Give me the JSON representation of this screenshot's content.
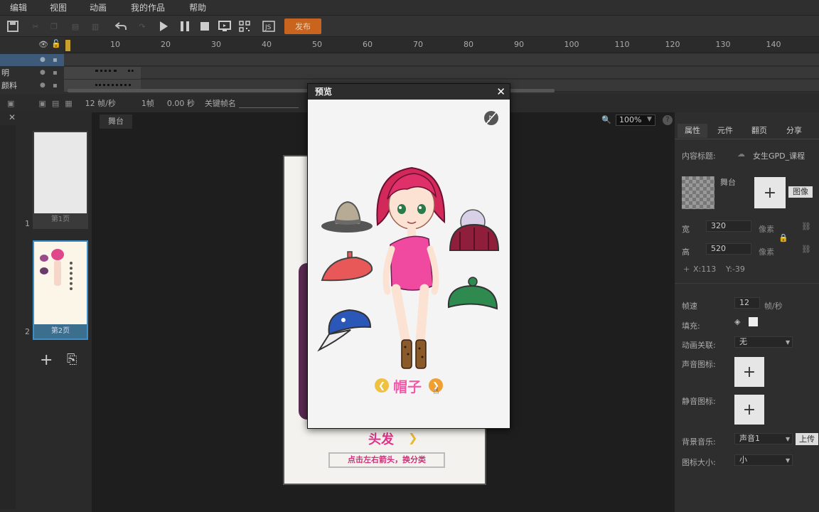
{
  "menubar": {
    "items": [
      "编辑",
      "视图",
      "动画",
      "我的作品",
      "帮助"
    ]
  },
  "toolbar": {
    "publish_label": "发布"
  },
  "timeline": {
    "ruler_ticks": [
      "10",
      "20",
      "30",
      "40",
      "50",
      "60",
      "70",
      "80",
      "90",
      "100",
      "110",
      "120",
      "130",
      "140"
    ],
    "layers": [
      "",
      "明",
      "颜料"
    ],
    "status": {
      "fps": "12 帧/秒",
      "frame": "1帧",
      "time": "0.00 秒",
      "keyframe_label": "关键帧名"
    }
  },
  "pages": {
    "items": [
      {
        "number": "1",
        "label": "第1页"
      },
      {
        "number": "2",
        "label": "第2页"
      }
    ]
  },
  "stage": {
    "tab_label": "舞台",
    "zoom": "100%"
  },
  "canvas": {
    "title_text": "头发",
    "hint_text": "点击左右箭头，换分类"
  },
  "preview": {
    "title": "预览",
    "close": "✕",
    "category_label": "帽子"
  },
  "props": {
    "tabs": [
      "属性",
      "元件",
      "翻页",
      "分享"
    ],
    "content_title_label": "内容标题:",
    "content_title_value": "女生GPD_课程",
    "stage_label": "舞台",
    "image_button": "图像",
    "width_label": "宽",
    "width_value": "320",
    "height_label": "高",
    "height_value": "520",
    "px_unit": "像素",
    "coord_x": "X:113",
    "coord_y": "Y:-39",
    "fps_label": "帧速",
    "fps_value": "12",
    "fps_unit": "帧/秒",
    "fill_label": "填充:",
    "anim_label": "动画关联:",
    "anim_value": "无",
    "sound_icon_label": "声音图标:",
    "mute_icon_label": "静音图标:",
    "bgm_label": "背景音乐:",
    "bgm_value": "声音1",
    "upload_button": "上传",
    "icon_size_label": "图标大小:",
    "icon_size_value": "小"
  }
}
